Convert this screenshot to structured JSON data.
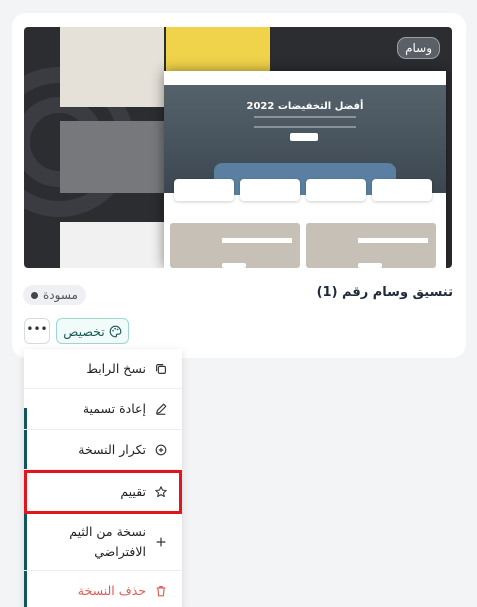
{
  "card": {
    "badge": "وسام",
    "title": "تنسيق وسام رقم (1)",
    "status": "مسودة",
    "customize_label": "تخصيص",
    "more_label": "•••"
  },
  "preview": {
    "hero_title": "أفضل التخفيضات 2022"
  },
  "menu": {
    "copy_link": "نسخ الرابط",
    "rename": "إعادة تسمية",
    "duplicate": "تكرار النسخة",
    "rate": "تقييم",
    "default_theme_copy": "نسخة من الثيم الافتراضي",
    "delete": "حذف النسخة"
  },
  "colors": {
    "accent": "#12545c",
    "danger": "#e25a55",
    "highlight": "#e0161e"
  }
}
